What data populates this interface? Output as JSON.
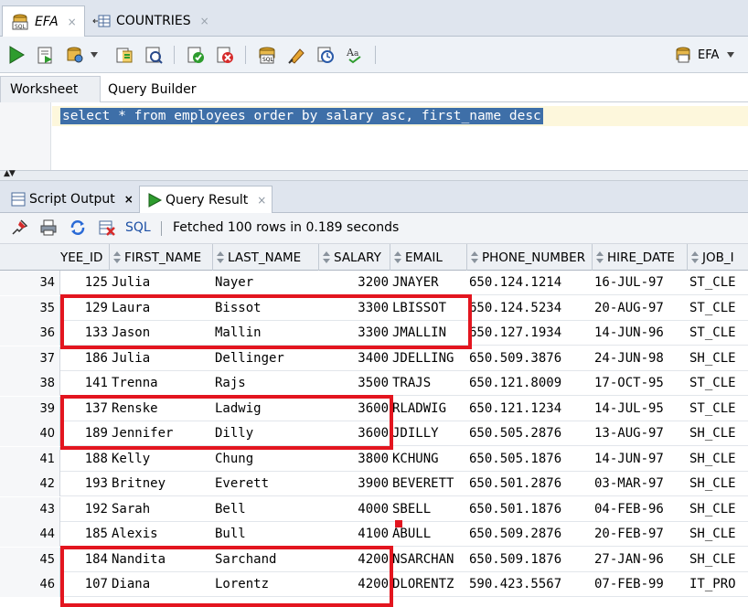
{
  "file_tabs": [
    {
      "label": "EFA",
      "close": "×"
    },
    {
      "label": "COUNTRIES",
      "close": "×"
    }
  ],
  "connection": {
    "label": "EFA"
  },
  "worksheet_tabs": [
    "Worksheet",
    "Query Builder"
  ],
  "editor": {
    "sql": "select * from employees order by salary asc, first_name desc"
  },
  "output_tabs": [
    {
      "label": "Script Output",
      "close": "×"
    },
    {
      "label": "Query Result",
      "close": "×"
    }
  ],
  "results_toolbar": {
    "sql_label": "SQL",
    "fetched": "Fetched 100 rows in 0.189 seconds"
  },
  "columns": [
    "YEE_ID",
    "FIRST_NAME",
    "LAST_NAME",
    "SALARY",
    "EMAIL",
    "PHONE_NUMBER",
    "HIRE_DATE",
    "JOB_I"
  ],
  "rows": [
    {
      "n": "34",
      "id": "125",
      "first": "Julia",
      "last": "Nayer",
      "salary": "3200",
      "email": "JNAYER",
      "phone": "650.124.1214",
      "hire": "16-JUL-97",
      "job": "ST_CLE"
    },
    {
      "n": "35",
      "id": "129",
      "first": "Laura",
      "last": "Bissot",
      "salary": "3300",
      "email": "LBISSOT",
      "phone": "650.124.5234",
      "hire": "20-AUG-97",
      "job": "ST_CLE"
    },
    {
      "n": "36",
      "id": "133",
      "first": "Jason",
      "last": "Mallin",
      "salary": "3300",
      "email": "JMALLIN",
      "phone": "650.127.1934",
      "hire": "14-JUN-96",
      "job": "ST_CLE"
    },
    {
      "n": "37",
      "id": "186",
      "first": "Julia",
      "last": "Dellinger",
      "salary": "3400",
      "email": "JDELLING",
      "phone": "650.509.3876",
      "hire": "24-JUN-98",
      "job": "SH_CLE"
    },
    {
      "n": "38",
      "id": "141",
      "first": "Trenna",
      "last": "Rajs",
      "salary": "3500",
      "email": "TRAJS",
      "phone": "650.121.8009",
      "hire": "17-OCT-95",
      "job": "ST_CLE"
    },
    {
      "n": "39",
      "id": "137",
      "first": "Renske",
      "last": "Ladwig",
      "salary": "3600",
      "email": "RLADWIG",
      "phone": "650.121.1234",
      "hire": "14-JUL-95",
      "job": "ST_CLE"
    },
    {
      "n": "40",
      "id": "189",
      "first": "Jennifer",
      "last": "Dilly",
      "salary": "3600",
      "email": "JDILLY",
      "phone": "650.505.2876",
      "hire": "13-AUG-97",
      "job": "SH_CLE"
    },
    {
      "n": "41",
      "id": "188",
      "first": "Kelly",
      "last": "Chung",
      "salary": "3800",
      "email": "KCHUNG",
      "phone": "650.505.1876",
      "hire": "14-JUN-97",
      "job": "SH_CLE"
    },
    {
      "n": "42",
      "id": "193",
      "first": "Britney",
      "last": "Everett",
      "salary": "3900",
      "email": "BEVERETT",
      "phone": "650.501.2876",
      "hire": "03-MAR-97",
      "job": "SH_CLE"
    },
    {
      "n": "43",
      "id": "192",
      "first": "Sarah",
      "last": "Bell",
      "salary": "4000",
      "email": "SBELL",
      "phone": "650.501.1876",
      "hire": "04-FEB-96",
      "job": "SH_CLE"
    },
    {
      "n": "44",
      "id": "185",
      "first": "Alexis",
      "last": "Bull",
      "salary": "4100",
      "email": "ABULL",
      "phone": "650.509.2876",
      "hire": "20-FEB-97",
      "job": "SH_CLE"
    },
    {
      "n": "45",
      "id": "184",
      "first": "Nandita",
      "last": "Sarchand",
      "salary": "4200",
      "email": "NSARCHAN",
      "phone": "650.509.1876",
      "hire": "27-JAN-96",
      "job": "SH_CLE"
    },
    {
      "n": "46",
      "id": "107",
      "first": "Diana",
      "last": "Lorentz",
      "salary": "4200",
      "email": "DLORENTZ",
      "phone": "590.423.5567",
      "hire": "07-FEB-99",
      "job": "IT_PRO"
    }
  ],
  "colors": {
    "highlight": "#e3151f",
    "selection": "#3e6fa8",
    "link": "#1c4fa4"
  },
  "icons": [
    "sql-worksheet-icon",
    "table-icon",
    "run-statement-icon",
    "run-script-icon",
    "autotrace-icon",
    "explain-plan-icon",
    "sql-tuning-icon",
    "commit-icon",
    "rollback-icon",
    "unshared-worksheet-icon",
    "clear-icon",
    "history-icon",
    "format-icon",
    "connection-icon",
    "pin-icon",
    "print-icon",
    "refresh-icon",
    "export-icon"
  ]
}
